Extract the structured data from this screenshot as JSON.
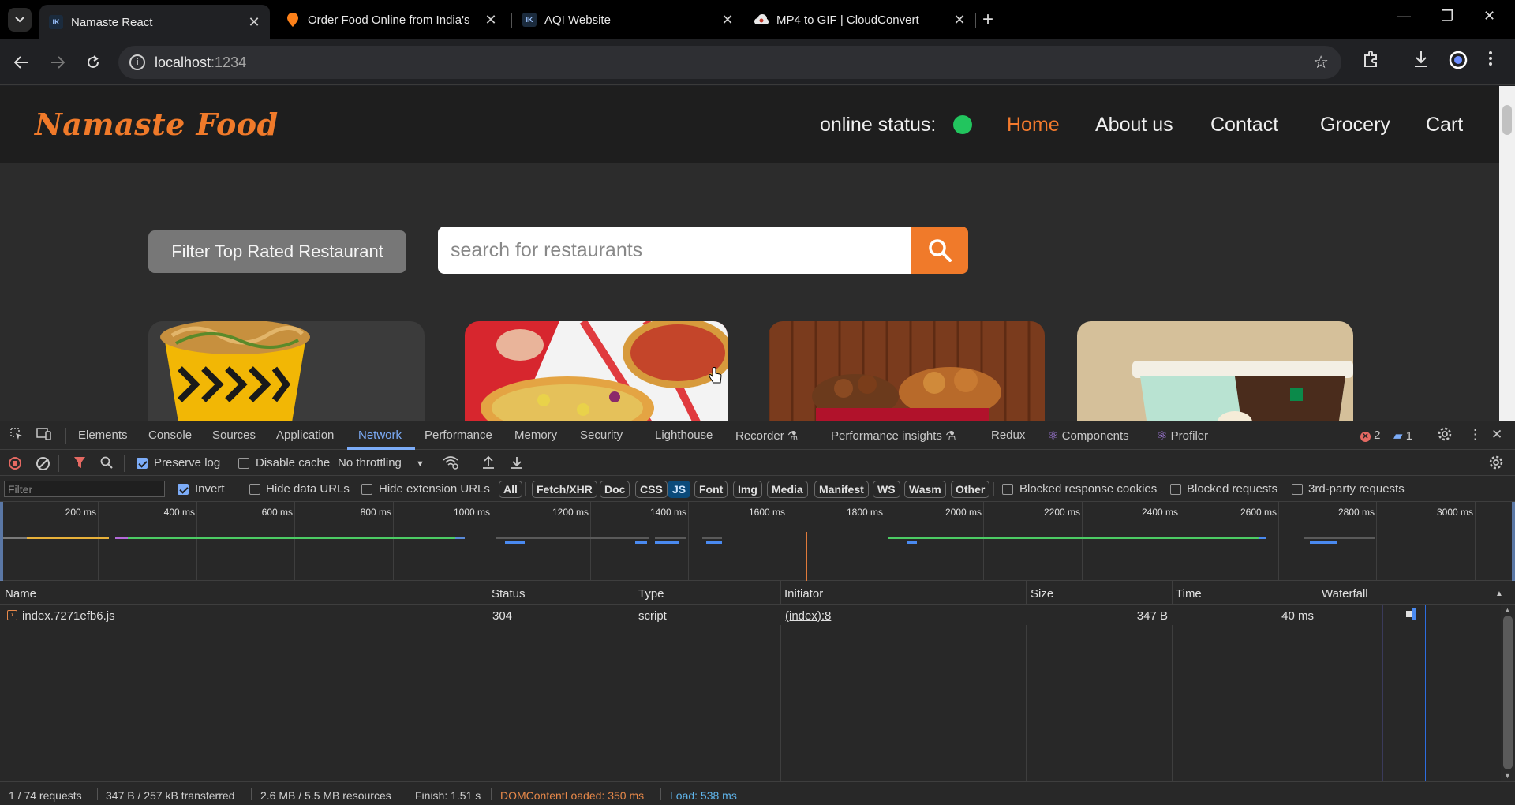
{
  "browser": {
    "tabs": [
      {
        "title": "Namaste React",
        "favicon": "react-icon",
        "active": true
      },
      {
        "title": "Order Food Online from India's",
        "favicon": "swiggy-icon",
        "active": false
      },
      {
        "title": "AQI Website",
        "favicon": "react-icon",
        "active": false
      },
      {
        "title": "MP4 to GIF | CloudConvert",
        "favicon": "cloudconvert-icon",
        "active": false
      }
    ],
    "favicon_text": "lK",
    "url_host": "localhost",
    "url_port": ":1234"
  },
  "page": {
    "logo": "Namaste Food",
    "online_status_label": "online status:",
    "nav": [
      "Home",
      "About us",
      "Contact",
      "Grocery",
      "Cart"
    ],
    "filter_button": "Filter Top Rated Restaurant",
    "search_placeholder": "search for restaurants",
    "colors": {
      "accent": "#f07a2a",
      "online": "#22c55e"
    }
  },
  "devtools": {
    "tabs": [
      "Elements",
      "Console",
      "Sources",
      "Application",
      "Network",
      "Performance",
      "Memory",
      "Security",
      "Lighthouse",
      "Recorder",
      "Performance insights",
      "Redux",
      "Components",
      "Profiler"
    ],
    "active_tab": "Network",
    "error_count": "2",
    "message_count": "1",
    "toolbar": {
      "preserve_log": "Preserve log",
      "disable_cache": "Disable cache",
      "throttling": "No throttling"
    },
    "filter": {
      "placeholder": "Filter",
      "invert": "Invert",
      "hide_data_urls": "Hide data URLs",
      "hide_extension_urls": "Hide extension URLs",
      "types": [
        "All",
        "Fetch/XHR",
        "Doc",
        "CSS",
        "JS",
        "Font",
        "Img",
        "Media",
        "Manifest",
        "WS",
        "Wasm",
        "Other"
      ],
      "active_type": "JS",
      "blocked_response_cookies": "Blocked response cookies",
      "blocked_requests": "Blocked requests",
      "third_party": "3rd-party requests"
    },
    "timeline_ticks": [
      "200 ms",
      "400 ms",
      "600 ms",
      "800 ms",
      "1000 ms",
      "1200 ms",
      "1400 ms",
      "1600 ms",
      "1800 ms",
      "2000 ms",
      "2200 ms",
      "2400 ms",
      "2600 ms",
      "2800 ms",
      "3000 ms"
    ],
    "columns": [
      "Name",
      "Status",
      "Type",
      "Initiator",
      "Size",
      "Time",
      "Waterfall"
    ],
    "rows": [
      {
        "name": "index.7271efb6.js",
        "status": "304",
        "type": "script",
        "initiator": "(index):8",
        "size": "347 B",
        "time": "40 ms"
      }
    ],
    "status": {
      "requests": "1 / 74 requests",
      "transferred": "347 B / 257 kB transferred",
      "resources": "2.6 MB / 5.5 MB resources",
      "finish": "Finish: 1.51 s",
      "dom_loaded": "DOMContentLoaded: 350 ms",
      "load": "Load: 538 ms"
    }
  }
}
